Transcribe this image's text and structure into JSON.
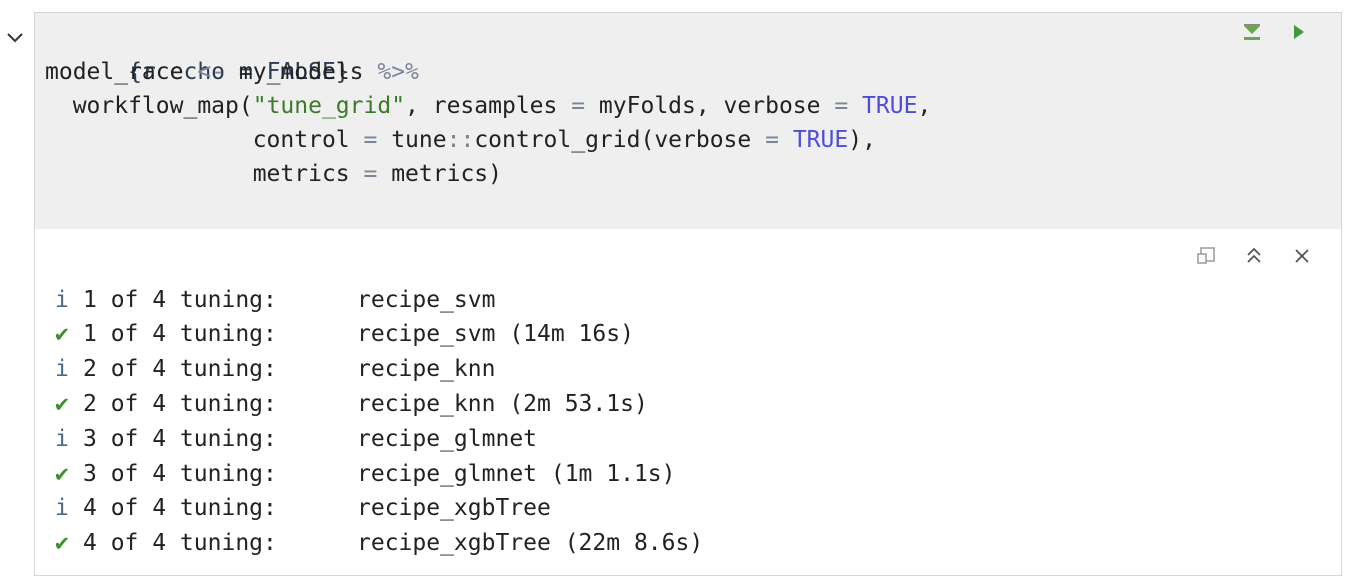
{
  "chunk": {
    "header": "{r echo = FALSE}",
    "code": {
      "line2_a": "model_race ",
      "line2_op": "<-",
      "line2_b": " my_models ",
      "line2_pipe": "%>%",
      "line3_a": "  workflow_map(",
      "line3_str": "\"tune_grid\"",
      "line3_b": ", resamples ",
      "line3_eq": "=",
      "line3_c": " myFolds, verbose ",
      "line3_eq2": "=",
      "line3_sp": " ",
      "line3_kw": "TRUE",
      "line3_d": ",",
      "line4_a": "               control ",
      "line4_eq": "=",
      "line4_b": " tune",
      "line4_ns": "::",
      "line4_c": "control_grid(verbose ",
      "line4_eq2": "=",
      "line4_sp": " ",
      "line4_kw": "TRUE",
      "line4_d": "),",
      "line5_a": "               metrics ",
      "line5_eq": "=",
      "line5_b": " metrics)"
    },
    "tools": {
      "run_previous_icon": "run-previous-chunks-icon",
      "run_chunk_icon": "run-chunk-icon"
    }
  },
  "output": {
    "tools": {
      "popout_icon": "popout-icon",
      "collapse_icon": "collapse-output-icon",
      "clear_icon": "clear-output-icon"
    },
    "lines": [
      {
        "mark": "i",
        "prefix": "1 of 4 tuning:",
        "text": "recipe_svm"
      },
      {
        "mark": "✔",
        "prefix": "1 of 4 tuning:",
        "text": "recipe_svm (14m 16s)"
      },
      {
        "mark": "i",
        "prefix": "2 of 4 tuning:",
        "text": "recipe_knn"
      },
      {
        "mark": "✔",
        "prefix": "2 of 4 tuning:",
        "text": "recipe_knn (2m 53.1s)"
      },
      {
        "mark": "i",
        "prefix": "3 of 4 tuning:",
        "text": "recipe_glmnet"
      },
      {
        "mark": "✔",
        "prefix": "3 of 4 tuning:",
        "text": "recipe_glmnet (1m 1.1s)"
      },
      {
        "mark": "i",
        "prefix": "4 of 4 tuning:",
        "text": "recipe_xgbTree"
      },
      {
        "mark": "✔",
        "prefix": "4 of 4 tuning:",
        "text": "recipe_xgbTree (22m 8.6s)"
      }
    ]
  },
  "colors": {
    "info_mark": "#4a6b8a",
    "done_mark": "#3f8f2f",
    "string": "#3c7a2b",
    "keyword": "#4d4ddb",
    "code_background": "#efefef"
  }
}
